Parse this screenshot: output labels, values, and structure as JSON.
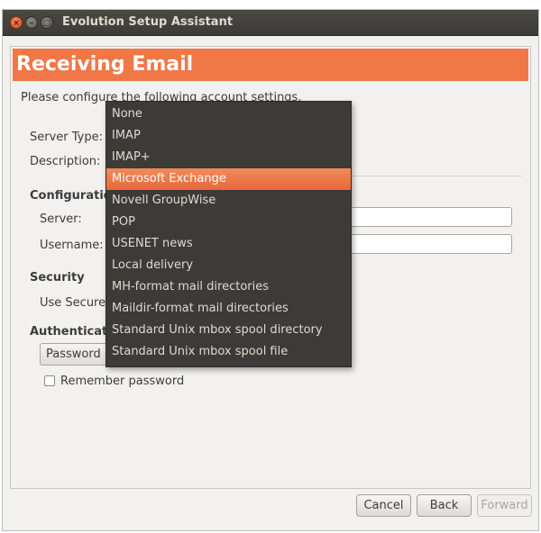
{
  "window": {
    "title": "Evolution Setup Assistant"
  },
  "header": {
    "title": "Receiving Email"
  },
  "intro": "Please configure the following account settings.",
  "form": {
    "server_type_label": "Server Type:",
    "description_label": "Description:",
    "configuration_heading": "Configuration",
    "server_label": "Server:",
    "username_label": "Username:",
    "security_heading": "Security",
    "use_secure_label": "Use Secure C",
    "authentication_heading": "Authenticatio",
    "auth_combo_value": "Password",
    "remember_password_label": "Remember password",
    "remember_password_checked": false
  },
  "dropdown": {
    "selected": "Microsoft Exchange",
    "options": [
      "None",
      "IMAP",
      "IMAP+",
      "Microsoft Exchange",
      "Novell GroupWise",
      "POP",
      "USENET news",
      "Local delivery",
      "MH-format mail directories",
      "Maildir-format mail directories",
      "Standard Unix mbox spool directory",
      "Standard Unix mbox spool file"
    ]
  },
  "buttons": {
    "cancel": "Cancel",
    "back": "Back",
    "forward": "Forward"
  },
  "colors": {
    "accent": "#f07746",
    "titlebar": "#3c3b37",
    "menu_bg": "#3c3b37",
    "menu_highlight": "#e9683a"
  }
}
